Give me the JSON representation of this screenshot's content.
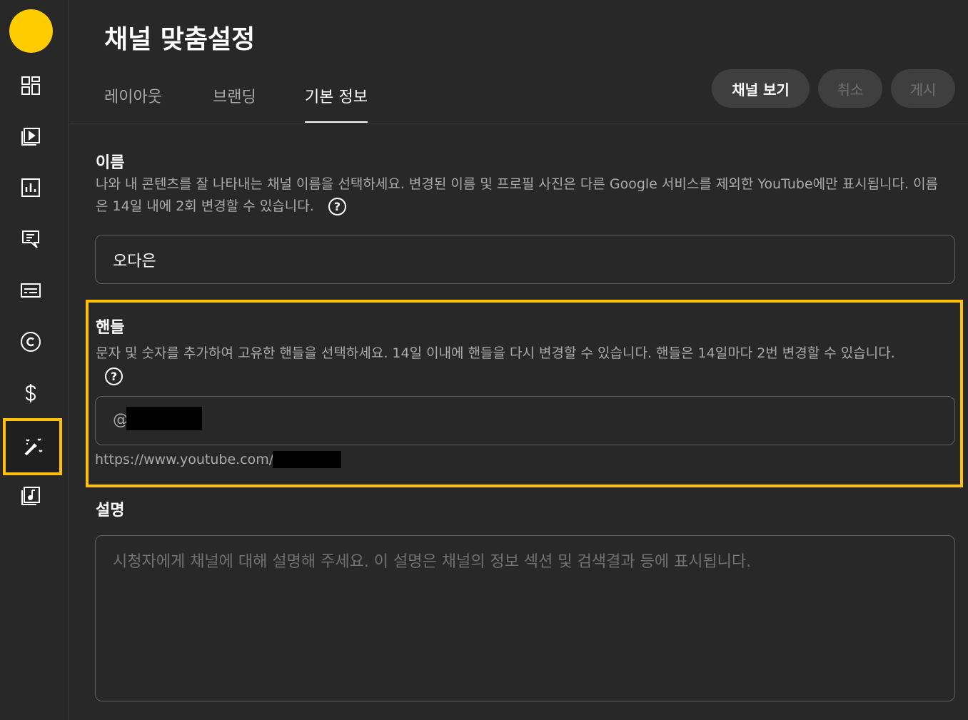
{
  "header": {
    "title": "채널 맞춤설정",
    "tabs": [
      {
        "label": "레이아웃",
        "active": false
      },
      {
        "label": "브랜딩",
        "active": false
      },
      {
        "label": "기본 정보",
        "active": true
      }
    ],
    "buttons": {
      "view_channel": "채널 보기",
      "cancel": "취소",
      "publish": "게시"
    }
  },
  "sidebar": {
    "avatar_color": "#ffcc00",
    "items": [
      {
        "icon": "dashboard-icon",
        "active": false
      },
      {
        "icon": "content-icon",
        "active": false
      },
      {
        "icon": "analytics-icon",
        "active": false
      },
      {
        "icon": "comments-icon",
        "active": false
      },
      {
        "icon": "subtitles-icon",
        "active": false
      },
      {
        "icon": "copyright-icon",
        "active": false
      },
      {
        "icon": "earn-icon",
        "active": false
      },
      {
        "icon": "customization-icon",
        "active": true
      },
      {
        "icon": "audio-library-icon",
        "active": false
      }
    ]
  },
  "name_section": {
    "title": "이름",
    "description": "나와 내 콘텐츠를 잘 나타내는 채널 이름을 선택하세요. 변경된 이름 및 프로필 사진은 다른 Google 서비스를 제외한 YouTube에만 표시됩니다. 이름은 14일 내에 2회 변경할 수 있습니다.",
    "value": "오다은"
  },
  "handle_section": {
    "title": "핸들",
    "description": "문자 및 숫자를 추가하여 고유한 핸들을 선택하세요. 14일 이내에 핸들을 다시 변경할 수 있습니다. 핸들은 14일마다 2번 변경할 수 있습니다.",
    "prefix": "@",
    "url_prefix": "https://www.youtube.com/@",
    "highlight_color": "#ffc107"
  },
  "description_section": {
    "title": "설명",
    "placeholder": "시청자에게 채널에 대해 설명해 주세요. 이 설명은 채널의 정보 섹션 및 검색결과 등에 표시됩니다."
  }
}
